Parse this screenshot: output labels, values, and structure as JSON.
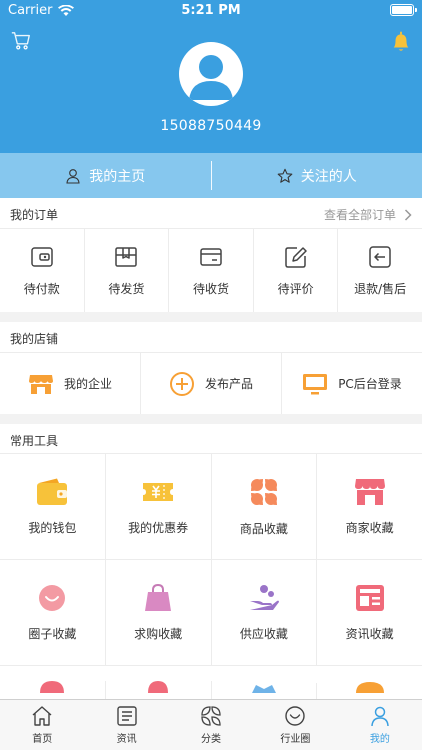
{
  "status_bar": {
    "carrier": "Carrier",
    "time": "5:21 PM"
  },
  "profile": {
    "phone": "15088750449"
  },
  "top_tabs": [
    {
      "label": "我的主页",
      "icon": "user-icon"
    },
    {
      "label": "关注的人",
      "icon": "star-icon"
    }
  ],
  "orders": {
    "title": "我的订单",
    "view_all": "查看全部订单",
    "items": [
      {
        "label": "待付款",
        "icon": "wallet-icon"
      },
      {
        "label": "待发货",
        "icon": "box-icon"
      },
      {
        "label": "待收货",
        "icon": "card-icon"
      },
      {
        "label": "待评价",
        "icon": "edit-icon"
      },
      {
        "label": "退款/售后",
        "icon": "return-icon"
      }
    ]
  },
  "shop": {
    "title": "我的店铺",
    "items": [
      {
        "label": "我的企业",
        "icon": "store-icon"
      },
      {
        "label": "发布产品",
        "icon": "plus-circle-icon"
      },
      {
        "label": "PC后台登录",
        "icon": "monitor-icon"
      }
    ]
  },
  "tools": {
    "title": "常用工具",
    "items": [
      {
        "label": "我的钱包",
        "icon": "wallet-icon"
      },
      {
        "label": "我的优惠券",
        "icon": "coupon-icon"
      },
      {
        "label": "商品收藏",
        "icon": "clover-icon"
      },
      {
        "label": "商家收藏",
        "icon": "shop-icon"
      },
      {
        "label": "圈子收藏",
        "icon": "smile-icon"
      },
      {
        "label": "求购收藏",
        "icon": "bag-icon"
      },
      {
        "label": "供应收藏",
        "icon": "hand-icon"
      },
      {
        "label": "资讯收藏",
        "icon": "news-icon"
      }
    ]
  },
  "bottom_nav": [
    {
      "label": "首页",
      "icon": "home-icon"
    },
    {
      "label": "资讯",
      "icon": "news-icon"
    },
    {
      "label": "分类",
      "icon": "category-icon"
    },
    {
      "label": "行业圈",
      "icon": "smile-icon"
    },
    {
      "label": "我的",
      "icon": "person-icon",
      "active": true
    }
  ],
  "colors": {
    "primary": "#3a9fe0",
    "tab_bar": "#86c7ee",
    "orange": "#f7a035",
    "pink": "#f06a7a",
    "purple": "#9a74c8"
  }
}
